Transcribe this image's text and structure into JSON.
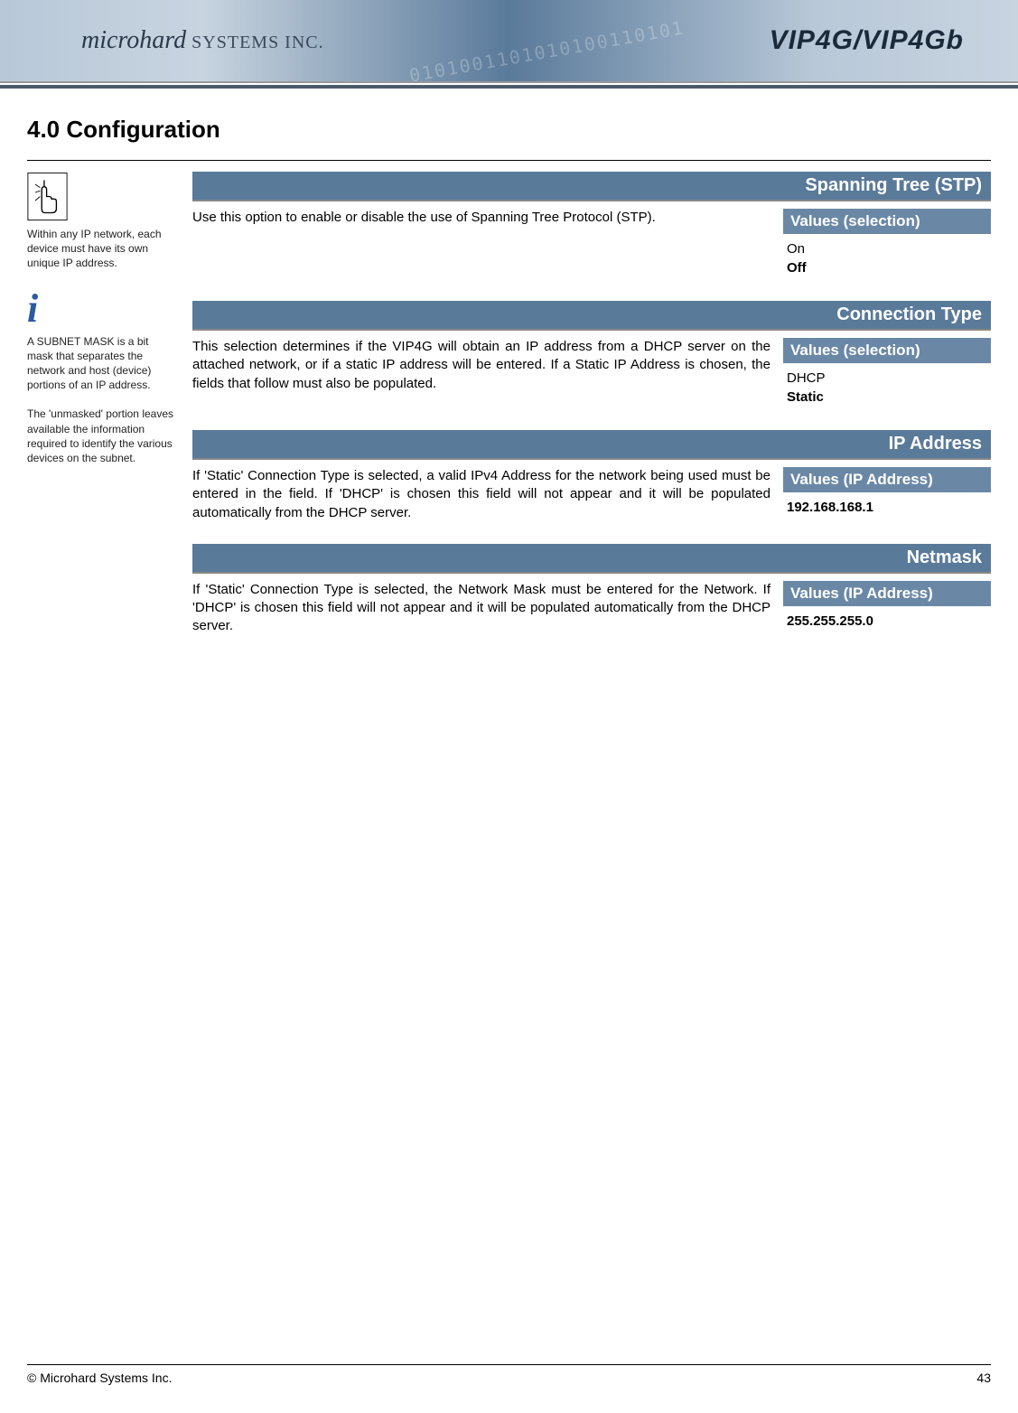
{
  "brand": {
    "left_bold": "microhard",
    "left_thin": " SYSTEMS INC.",
    "right": "VIP4G/VIP4Gb"
  },
  "section_title": "4.0  Configuration",
  "sidebar": {
    "note1": "Within any IP network, each device must have its own unique IP address.",
    "note2": "A SUBNET MASK is a bit mask that separates the network and host (device) portions of an IP address.",
    "note3": "The 'unmasked' portion leaves available the information required to identify the various devices on the subnet."
  },
  "params": [
    {
      "title": "Spanning Tree (STP)",
      "desc": "Use this option to enable or disable the use of Spanning Tree Protocol (STP).",
      "values_label": "Values (selection)",
      "values": [
        {
          "text": "On",
          "bold": false
        },
        {
          "text": "Off",
          "bold": true
        }
      ]
    },
    {
      "title": "Connection Type",
      "desc": "This selection determines if the VIP4G will obtain an IP address from a DHCP server on the attached network, or if a static IP address will be entered. If a Static IP Address is chosen, the fields that follow must also be populated.",
      "values_label": "Values (selection)",
      "values": [
        {
          "text": "DHCP",
          "bold": false
        },
        {
          "text": "Static",
          "bold": true
        }
      ]
    },
    {
      "title": "IP Address",
      "desc": "If 'Static' Connection Type is selected, a valid IPv4 Address for the network being used must be entered in the field. If 'DHCP' is chosen this field will not appear and it will be populated automatically from the DHCP server.",
      "values_label": "Values (IP Address)",
      "values": [
        {
          "text": "192.168.168.1",
          "bold": true
        }
      ]
    },
    {
      "title": "Netmask",
      "desc": "If 'Static' Connection Type is selected, the Network Mask must be entered for the Network. If 'DHCP' is chosen this field will not appear and it will be populated automatically from the DHCP server.",
      "values_label": "Values (IP Address)",
      "values": [
        {
          "text": "255.255.255.0",
          "bold": true
        }
      ]
    }
  ],
  "footer": {
    "copyright": "© Microhard Systems Inc.",
    "page": "43"
  }
}
